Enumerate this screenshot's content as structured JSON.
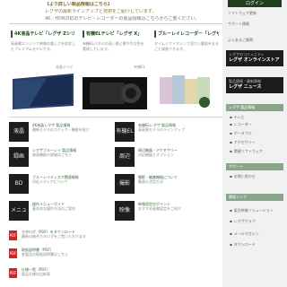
{
  "hero": {
    "line1": "【より詳しい製品情報はこちら】",
    "line2": "レグザの最新ラインアップと技術をご紹介しています。",
    "line3": "4K／HDR対応のテレビ・レコーダーの製品情報はこちらからご覧ください。"
  },
  "cards": [
    {
      "title": "4K液晶テレビ「レグザ Zシリーズ」",
      "desc": "高画質エンジンで映像の美しさを追求したプレミアムモデルです。",
      "caption": "液晶テレビ"
    },
    {
      "title": "有機ELテレビ「レグザ X」",
      "desc": "有機ELパネルの深い黒と鮮やかな色を実現しています。",
      "caption": "有機EL"
    },
    {
      "title": "ブルーレイレコーダー「レグザブルーレイ」",
      "desc": "タイムシフトマシンで見たい番組をまるごと録画できます。",
      "caption": ""
    }
  ],
  "products": [
    {
      "label": "液晶",
      "heading": "4K液晶レグザ 製品情報",
      "desc": "最新モデルのスペック・機能を紹介"
    },
    {
      "label": "有機EL",
      "heading": "有機ELレグザ 製品情報",
      "desc": "高画質モデルのラインアップ"
    },
    {
      "label": "録画",
      "heading": "レグザブルーレイ 製品情報",
      "desc": "録画機能の詳細はこちら"
    },
    {
      "label": "周辺",
      "heading": "周辺機器・アクセサリー",
      "desc": "対応機器とオプション"
    },
    {
      "label": "BD",
      "heading": "ブルーレイディスク関連情報",
      "desc": "対応メディアについて"
    },
    {
      "label": "撮影",
      "heading": "撮影・編集機能について",
      "desc": "動画の活用方法"
    },
    {
      "label": "メニュー",
      "heading": "操作メニューガイド",
      "desc": "基本的な操作方法のご案内"
    },
    {
      "label": "映像",
      "heading": "映像設定のポイント",
      "desc": "おすすめ画質設定をご紹介"
    }
  ],
  "news": [
    {
      "heading": "カタログ（PDF）をダウンロード",
      "desc": "最新の総合カタログをご覧いただけます"
    },
    {
      "heading": "取扱説明書（PDF）",
      "desc": "各製品の取扱説明書はこちら"
    },
    {
      "heading": "仕様一覧（PDF）",
      "desc": "製品仕様の比較表"
    }
  ],
  "sidebar": {
    "top_button": "ログイン",
    "links": [
      "ソフトウェア更新",
      "サポート情報",
      "よくあるご質問"
    ],
    "dark_boxes": [
      {
        "small": "レグザのコミュニティ",
        "large": "レグザ オンラインストア"
      },
      {
        "small": "製品情報・最新情報",
        "large": "レグザ ニュース"
      }
    ],
    "section1": {
      "title": "レグザ 製品情報",
      "items": [
        "テレビ",
        "レコーダー",
        "ポータブル",
        "アクセサリー",
        "関連ソフトウェア"
      ]
    },
    "section2": {
      "title": "サポート",
      "items": [
        "お問い合わせ"
      ]
    },
    "section3": {
      "title": "関連リンク",
      "items": [
        "東芝映像ソリューション",
        "レグザクラブ",
        "メールマガジン",
        "ダウンロード"
      ]
    }
  },
  "colors": {
    "brand_green": "#2f5a2f",
    "dark": "#1c1c1c",
    "pdf_red": "#c42a2a"
  }
}
